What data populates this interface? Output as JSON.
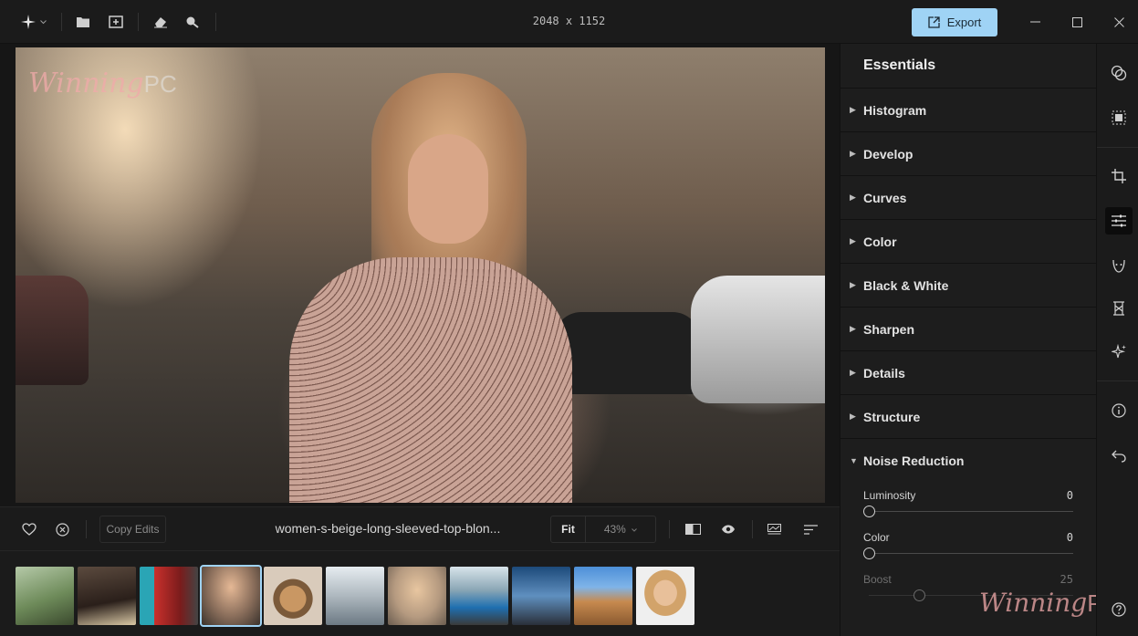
{
  "titlebar": {
    "dimensions": "2048 x 1152",
    "export_label": "Export"
  },
  "canvas": {
    "watermark_brand": "Winning",
    "watermark_suffix": "PC"
  },
  "bottom_bar": {
    "copy_edits_label": "Copy Edits",
    "filename": "women-s-beige-long-sleeved-top-blon...",
    "fit_label": "Fit",
    "zoom_value": "43%"
  },
  "panel": {
    "title": "Essentials",
    "sections": [
      {
        "label": "Histogram"
      },
      {
        "label": "Develop"
      },
      {
        "label": "Curves"
      },
      {
        "label": "Color"
      },
      {
        "label": "Black & White"
      },
      {
        "label": "Sharpen"
      },
      {
        "label": "Details"
      },
      {
        "label": "Structure"
      },
      {
        "label": "Noise Reduction"
      }
    ],
    "noise_reduction": {
      "luminosity_label": "Luminosity",
      "luminosity_value": "0",
      "color_label": "Color",
      "color_value": "0",
      "boost_label": "Boost",
      "boost_value": "25"
    }
  },
  "filmstrip": {
    "selected_index": 3,
    "thumbnail_count": 11
  },
  "colors": {
    "accent": "#9fd3f5",
    "background": "#1b1b1b",
    "panel": "#1d1d1d"
  }
}
